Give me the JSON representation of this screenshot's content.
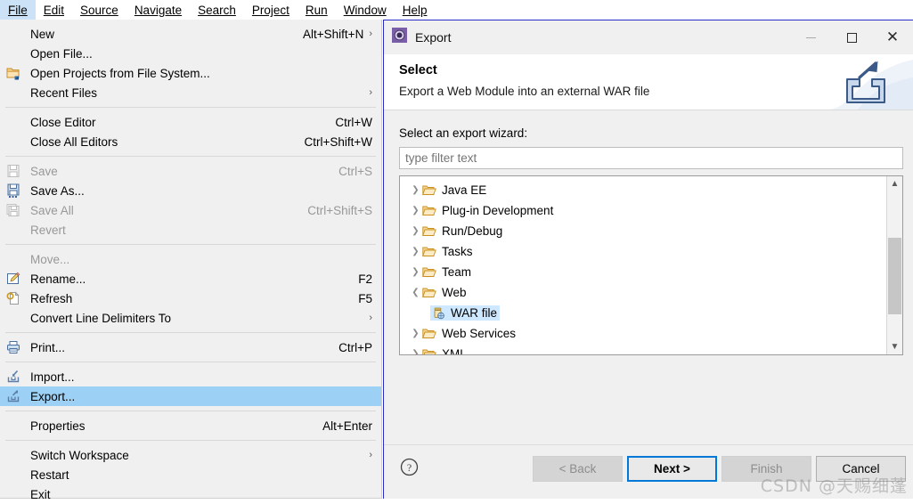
{
  "menubar": {
    "items": [
      {
        "label": "File",
        "active": true
      },
      {
        "label": "Edit",
        "active": false
      },
      {
        "label": "Source",
        "active": false
      },
      {
        "label": "Navigate",
        "active": false
      },
      {
        "label": "Search",
        "active": false
      },
      {
        "label": "Project",
        "active": false
      },
      {
        "label": "Run",
        "active": false
      },
      {
        "label": "Window",
        "active": false
      },
      {
        "label": "Help",
        "active": false
      }
    ]
  },
  "file_menu": {
    "items": [
      {
        "label": "New",
        "accel": "Alt+Shift+N",
        "submenu": true,
        "icon": "",
        "disabled": false,
        "highlight": false
      },
      {
        "label": "Open File...",
        "accel": "",
        "submenu": false,
        "icon": "",
        "disabled": false,
        "highlight": false
      },
      {
        "label": "Open Projects from File System...",
        "accel": "",
        "submenu": false,
        "icon": "folder-open-icon",
        "disabled": false,
        "highlight": false
      },
      {
        "label": "Recent Files",
        "accel": "",
        "submenu": true,
        "icon": "",
        "disabled": false,
        "highlight": false
      },
      {
        "separator": true
      },
      {
        "label": "Close Editor",
        "accel": "Ctrl+W",
        "submenu": false,
        "icon": "",
        "disabled": false,
        "highlight": false
      },
      {
        "label": "Close All Editors",
        "accel": "Ctrl+Shift+W",
        "submenu": false,
        "icon": "",
        "disabled": false,
        "highlight": false
      },
      {
        "separator": true
      },
      {
        "label": "Save",
        "accel": "Ctrl+S",
        "submenu": false,
        "icon": "save-icon-disabled",
        "disabled": true,
        "highlight": false
      },
      {
        "label": "Save As...",
        "accel": "",
        "submenu": false,
        "icon": "save-as-icon",
        "disabled": false,
        "highlight": false
      },
      {
        "label": "Save All",
        "accel": "Ctrl+Shift+S",
        "submenu": false,
        "icon": "save-all-icon-disabled",
        "disabled": true,
        "highlight": false
      },
      {
        "label": "Revert",
        "accel": "",
        "submenu": false,
        "icon": "",
        "disabled": true,
        "highlight": false
      },
      {
        "separator": true
      },
      {
        "label": "Move...",
        "accel": "",
        "submenu": false,
        "icon": "",
        "disabled": true,
        "highlight": false
      },
      {
        "label": "Rename...",
        "accel": "F2",
        "submenu": false,
        "icon": "rename-icon",
        "disabled": false,
        "highlight": false
      },
      {
        "label": "Refresh",
        "accel": "F5",
        "submenu": false,
        "icon": "refresh-icon",
        "disabled": false,
        "highlight": false
      },
      {
        "label": "Convert Line Delimiters To",
        "accel": "",
        "submenu": true,
        "icon": "",
        "disabled": false,
        "highlight": false
      },
      {
        "separator": true
      },
      {
        "label": "Print...",
        "accel": "Ctrl+P",
        "submenu": false,
        "icon": "print-icon",
        "disabled": false,
        "highlight": false
      },
      {
        "separator": true
      },
      {
        "label": "Import...",
        "accel": "",
        "submenu": false,
        "icon": "import-icon",
        "disabled": false,
        "highlight": false
      },
      {
        "label": "Export...",
        "accel": "",
        "submenu": false,
        "icon": "export-icon",
        "disabled": false,
        "highlight": true
      },
      {
        "separator": true
      },
      {
        "label": "Properties",
        "accel": "Alt+Enter",
        "submenu": false,
        "icon": "",
        "disabled": false,
        "highlight": false
      },
      {
        "separator": true
      },
      {
        "label": "Switch Workspace",
        "accel": "",
        "submenu": true,
        "icon": "",
        "disabled": false,
        "highlight": false
      },
      {
        "label": "Restart",
        "accel": "",
        "submenu": false,
        "icon": "",
        "disabled": false,
        "highlight": false
      },
      {
        "label": "Exit",
        "accel": "",
        "submenu": false,
        "icon": "",
        "disabled": false,
        "highlight": false
      }
    ]
  },
  "dialog": {
    "title": "Export",
    "titlebar_icon": "eclipse-wizard-icon",
    "window_buttons": {
      "minimize": "minimize-icon",
      "maximize": "maximize-icon",
      "close": "close-icon"
    },
    "header": {
      "title": "Select",
      "description": "Export a Web Module into an external WAR file",
      "icon": "export-banner-icon"
    },
    "body": {
      "label": "Select an export wizard:",
      "filter": {
        "value": "",
        "placeholder": "type filter text"
      },
      "tree": [
        {
          "label": "Java EE",
          "expanded": false,
          "selected": false,
          "level": 0,
          "icon": "folder-icon"
        },
        {
          "label": "Plug-in Development",
          "expanded": false,
          "selected": false,
          "level": 0,
          "icon": "folder-icon"
        },
        {
          "label": "Run/Debug",
          "expanded": false,
          "selected": false,
          "level": 0,
          "icon": "folder-icon"
        },
        {
          "label": "Tasks",
          "expanded": false,
          "selected": false,
          "level": 0,
          "icon": "folder-icon"
        },
        {
          "label": "Team",
          "expanded": false,
          "selected": false,
          "level": 0,
          "icon": "folder-icon"
        },
        {
          "label": "Web",
          "expanded": true,
          "selected": false,
          "level": 0,
          "icon": "folder-icon"
        },
        {
          "label": "WAR file",
          "expanded": null,
          "selected": true,
          "level": 1,
          "icon": "war-file-icon"
        },
        {
          "label": "Web Services",
          "expanded": false,
          "selected": false,
          "level": 0,
          "icon": "folder-icon"
        },
        {
          "label": "XML",
          "expanded": false,
          "selected": false,
          "level": 0,
          "icon": "folder-icon"
        }
      ]
    },
    "footer": {
      "help_icon": "help-icon",
      "buttons": [
        {
          "label": "< Back",
          "state": "disabled"
        },
        {
          "label": "Next >",
          "state": "default"
        },
        {
          "label": "Finish",
          "state": "disabled"
        },
        {
          "label": "Cancel",
          "state": "enabled"
        }
      ]
    }
  },
  "watermark": {
    "text": "CSDN @天赐细蓬"
  },
  "colors": {
    "menu_highlight": "#9cd0f5",
    "menubar_active": "#cce3f7",
    "tree_selection": "#cde8ff",
    "default_button_border": "#0078d7",
    "dialog_border": "#2c2cc8"
  }
}
